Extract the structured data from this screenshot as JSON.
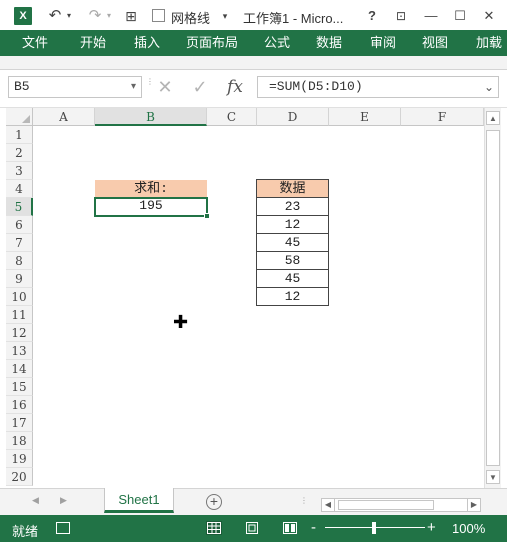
{
  "titlebar": {
    "app_icon": "X",
    "undo_icon": "undo-icon",
    "redo_icon": "redo-icon",
    "qat_icon": "table-grid-icon",
    "gridlines_label": "网格线",
    "gridlines_checked": false,
    "customize_icon": "chevron-down-icon",
    "title": "工作簿1 - Micro...",
    "help": "?",
    "restore_icon": "ribbon-display-icon",
    "minimize": "—",
    "maximize": "☐",
    "close": "✕"
  },
  "ribbon": {
    "tabs": [
      "文件",
      "开始",
      "插入",
      "页面布局",
      "公式",
      "数据",
      "审阅",
      "视图",
      "加载"
    ]
  },
  "formula_bar": {
    "name_box": "B5",
    "cancel_icon": "✕",
    "enter_icon": "✓",
    "function_icon": "fx",
    "formula": "=SUM(D5:D10)"
  },
  "grid": {
    "columns": [
      "A",
      "B",
      "C",
      "D",
      "E",
      "F"
    ],
    "selected_column": "B",
    "rows": [
      "1",
      "2",
      "3",
      "4",
      "5",
      "6",
      "7",
      "8",
      "9",
      "10",
      "11",
      "12",
      "13",
      "14",
      "15",
      "16",
      "17",
      "18",
      "19",
      "20"
    ],
    "selected_row": "5",
    "sum_header": "求和:",
    "sum_value": "195",
    "data_header": "数据",
    "data_values": [
      "23",
      "12",
      "45",
      "58",
      "45",
      "12"
    ],
    "header_fill": "#f8cbad",
    "active_border": "#217346"
  },
  "sheets": {
    "tabs": [
      "Sheet1"
    ],
    "active": "Sheet1",
    "add_icon": "+"
  },
  "status": {
    "ready": "就绪",
    "zoom_minus": "-",
    "zoom_plus": "+",
    "zoom": "100%"
  },
  "accent": "#217346"
}
